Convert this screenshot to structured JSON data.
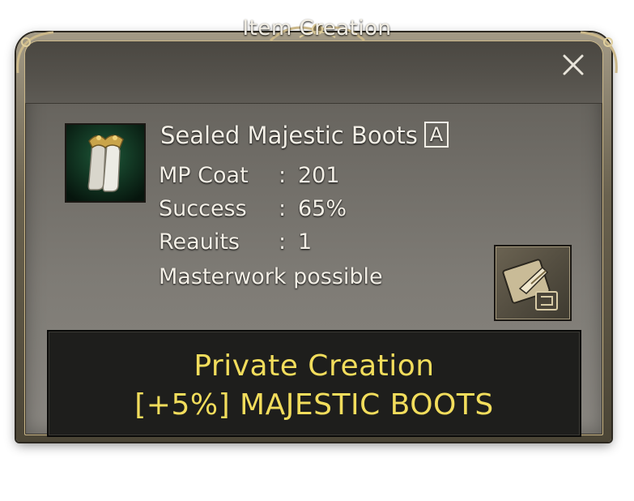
{
  "window": {
    "title": "Item Creation",
    "close_icon": "close-icon"
  },
  "item": {
    "icon": "majestic-boots-icon",
    "name": "Sealed Majestic Boots",
    "grade": "A"
  },
  "stats": [
    {
      "label": "MP Coat",
      "sep": ":",
      "value": "201"
    },
    {
      "label": "Success",
      "sep": ":",
      "value": "65%"
    },
    {
      "label": "Reauits",
      "sep": ":",
      "value": "1"
    }
  ],
  "note": "Masterwork possible",
  "recipe_icon": "recipe-book-icon",
  "create_button": {
    "line1": "Private Creation",
    "line2": "[+5%] MAJESTIC BOOTS"
  },
  "colors": {
    "accent_gold": "#f2dd5c",
    "text_light": "#f3efe6",
    "frame_trim": "#cbb88a"
  }
}
